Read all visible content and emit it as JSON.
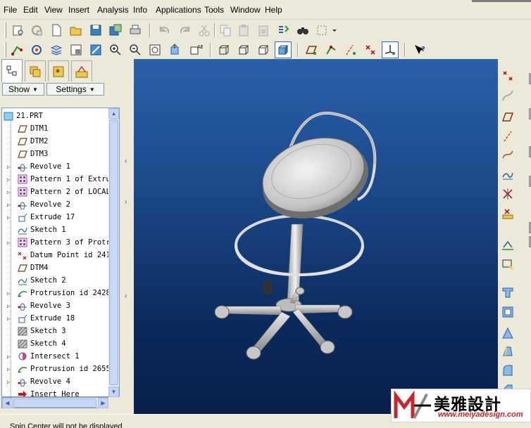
{
  "menu": [
    "File",
    "Edit",
    "View",
    "Insert",
    "Analysis",
    "Info",
    "Applications",
    "Tools",
    "Window",
    "Help"
  ],
  "panel": {
    "show_label": "Show",
    "settings_label": "Settings",
    "tabs": [
      "model-tree-tab",
      "layers-tab",
      "favorites-tab",
      "connections-tab"
    ]
  },
  "tree": {
    "root": "21.PRT",
    "items": [
      {
        "label": "DTM1",
        "icon": "datum-plane-icon",
        "expandable": false
      },
      {
        "label": "DTM2",
        "icon": "datum-plane-icon",
        "expandable": false
      },
      {
        "label": "DTM3",
        "icon": "datum-plane-icon",
        "expandable": false
      },
      {
        "label": "Revolve 1",
        "icon": "revolve-icon",
        "expandable": true
      },
      {
        "label": "Pattern 1 of Extru",
        "icon": "pattern-icon",
        "expandable": true
      },
      {
        "label": "Pattern 2 of LOCAL",
        "icon": "pattern-icon",
        "expandable": true
      },
      {
        "label": "Revolve 2",
        "icon": "revolve-icon",
        "expandable": true
      },
      {
        "label": "Extrude 17",
        "icon": "extrude-icon",
        "expandable": true
      },
      {
        "label": "Sketch 1",
        "icon": "sketch-icon",
        "expandable": false
      },
      {
        "label": "Pattern 3 of Protr",
        "icon": "pattern-icon",
        "expandable": true
      },
      {
        "label": "Datum Point id 241",
        "icon": "datum-point-icon",
        "expandable": false
      },
      {
        "label": "DTM4",
        "icon": "datum-plane-icon",
        "expandable": false
      },
      {
        "label": "Sketch 2",
        "icon": "sketch-icon",
        "expandable": false
      },
      {
        "label": "Protrusion id 2428",
        "icon": "protrusion-icon",
        "expandable": true
      },
      {
        "label": "Revolve 3",
        "icon": "revolve-icon",
        "expandable": true
      },
      {
        "label": "Extrude 18",
        "icon": "extrude-icon",
        "expandable": true
      },
      {
        "label": "Sketch 3",
        "icon": "sketch-hatched-icon",
        "expandable": false
      },
      {
        "label": "Sketch 4",
        "icon": "sketch-hatched-icon",
        "expandable": false
      },
      {
        "label": "Intersect 1",
        "icon": "intersect-icon",
        "expandable": true
      },
      {
        "label": "Protrusion id 2655",
        "icon": "protrusion-icon",
        "expandable": true
      },
      {
        "label": "Revolve 4",
        "icon": "revolve-icon",
        "expandable": true
      },
      {
        "label": "Insert Here",
        "icon": "insert-here-arrow-icon",
        "expandable": false
      }
    ]
  },
  "status": {
    "message": "Spin Center will not be displayed"
  },
  "watermark": {
    "brand_cn": "美雅設計",
    "url": "www.meiyadesign.com"
  },
  "colors": {
    "viewport_top": "#2a60a8",
    "viewport_bottom": "#08204a",
    "accent_red": "#c9242b",
    "model_grey": "#c8c8c8"
  }
}
